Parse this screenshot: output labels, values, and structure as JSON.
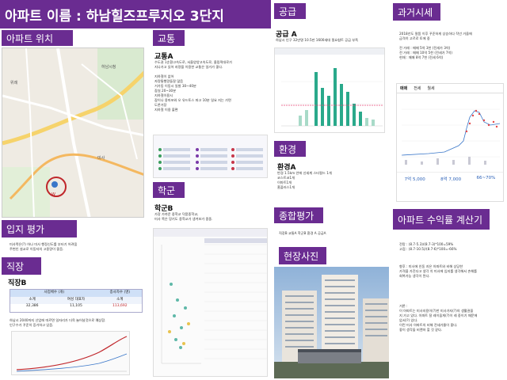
{
  "title": "아파트 이름 : 하남힐즈프루지오 3단지",
  "sections": {
    "location": {
      "title": "아파트 위치"
    },
    "transport": {
      "title": "교통",
      "grade": "교통A",
      "lines": [
        "수도권 1순환고속도로, 서울양양고속도로, 올림픽대로가",
        "지나가고 있어 자량을 이용한 교통은 일거가 좋다.",
        "",
        "지하철이 없어",
        "자량통행량들잘 많음",
        "거가동 이동시 일발 30~40분",
        "잠실 20~30분",
        "지하철이용시",
        "잠이나 용마포와 오 유드토스 파고 10분 일요 지는 가면",
        "도론거장",
        "지하철 이용 불편"
      ]
    },
    "supply": {
      "title": "공급",
      "grade": "공급 A",
      "line": "하남시 인구 32만명 10.5만 1600세대 필요참트 공급 부족"
    },
    "past_price": {
      "title": "과거시세",
      "lines": [
        "2018년도 말쯤 이후 꾸준하게 상승하다 작년 거을에",
        "급격히 고르로 토에 중",
        "",
        "전 거래 : 매매 5억 3천 (전세가 3억)",
        "전 거래 : 매매 10억 5천 (전세가 7억)",
        "현재 : 매매 8억 7천 (전세 6억)"
      ],
      "tabs": [
        "매매",
        "전세",
        "월세"
      ],
      "stats": [
        "7억 5,000",
        "8억 7,000",
        "66~70%"
      ]
    },
    "environment": {
      "title": "환경",
      "grade": "환경A",
      "lines": [
        "반경 1.5km 안에 신세계 스타필드 1개",
        "코스트코1개",
        "이마트1개",
        "홈플러스1개"
      ]
    },
    "school": {
      "title": "학군",
      "grade": "학군B",
      "lines": [
        "가장 가까운 중학교 덕풍중학교,",
        "미사 쪽은 망기도 중학교가 생겨보가 중중."
      ]
    },
    "location_eval": {
      "title": "입지 평가",
      "lines": [
        "미사쪽은(?) 하나 미사 행정신도를 부터기 어려움",
        "주변인 설교로 이동자의 고용량이 좋음."
      ]
    },
    "overall": {
      "title": "종합평가",
      "line": "직장B 교통A 학군B 환경 A 공급A"
    },
    "photo": {
      "title": "현장사진"
    },
    "return_calc": {
      "title": "아파트 수익률 계산기",
      "lines_1": [
        "전망 : (8.7-5.3)/(8.7-3)*100=59%",
        "고점 : (8.7-10.5)/(8.7-6)*100=-66%"
      ],
      "lines_2": [
        "향후 : 미사에 인동 지은 아파트와 비해 상당한",
        "가격을 가진다고 생각 치 미사에 입지를 생각해서 손해를",
        "회복가능 생각이 된다."
      ],
      "lines_3": [
        "거론 :",
        "이 아파트는 미사지용이(?)한 미사가지(?)의 생활권을",
        "지 가고 있다. 아파트 잘 레이옵게(?)이 레 중이기 때문에",
        "압서(?) 있다.",
        "이런 미사 아파트의 비해 전세가율이 좋다.",
        "좋이 생각들 비랜하 할 것 같다."
      ]
    },
    "job": {
      "title": "직장",
      "grade": "직장B",
      "table": {
        "header": [
          "사업체수 (개)",
          "종사자수 (명)"
        ],
        "sub": [
          "소계",
          "여성 대표자",
          "소계"
        ],
        "values": [
          "32,386",
          "11,105",
          "113,692"
        ]
      },
      "lines": [
        "하남시 2040까지 산업에 따르면 일자리가 더욱 늘어날것으로 예상함.",
        "인구수가 꾸준히 증가하고 있음."
      ]
    }
  },
  "map_labels": [
    "하남시청",
    "위례",
    "미사",
    "W"
  ],
  "colors": {
    "header": "#6a2c91",
    "accent": "#2aa98b"
  }
}
